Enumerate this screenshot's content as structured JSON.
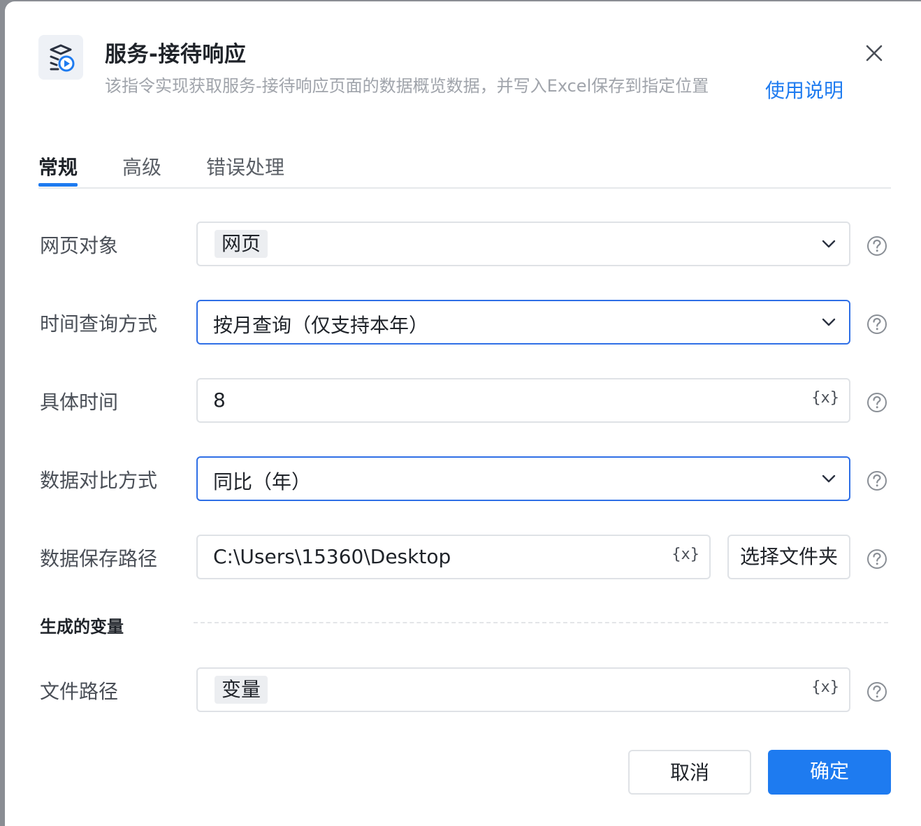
{
  "dialog": {
    "title": "服务-接待响应",
    "description": "该指令实现获取服务-接待响应页面的数据概览数据，并写入Excel保存到指定位置",
    "help_link": "使用说明"
  },
  "tabs": [
    {
      "label": "常规",
      "active": true
    },
    {
      "label": "高级",
      "active": false
    },
    {
      "label": "错误处理",
      "active": false
    }
  ],
  "fields": {
    "page_object": {
      "label": "网页对象",
      "value": "网页"
    },
    "time_query_mode": {
      "label": "时间查询方式",
      "value": "按月查询（仅支持本年）"
    },
    "specific_time": {
      "label": "具体时间",
      "value": "8"
    },
    "compare_mode": {
      "label": "数据对比方式",
      "value": "同比（年）"
    },
    "save_path": {
      "label": "数据保存路径",
      "value": "C:\\Users\\15360\\Desktop",
      "button": "选择文件夹"
    }
  },
  "variable_icon_text": "{x}",
  "generated": {
    "section_title": "生成的变量",
    "file_path": {
      "label": "文件路径",
      "value": "变量"
    }
  },
  "footer": {
    "cancel": "取消",
    "confirm": "确定"
  },
  "colors": {
    "accent": "#1e7bf0",
    "focus_border": "#2f6fe6",
    "border": "#dfe2e6",
    "text": "#1f2329",
    "muted": "#a0a4ab"
  }
}
